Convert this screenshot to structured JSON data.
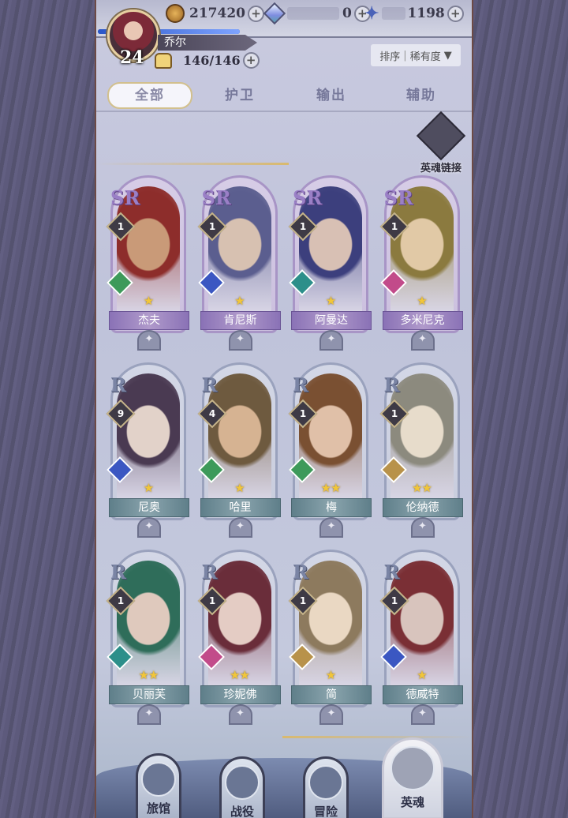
{
  "resources": {
    "gold": "217420",
    "crystal": "0",
    "star_gem": "1198"
  },
  "player": {
    "name": "乔尔",
    "level": "24",
    "stamina": "146/146"
  },
  "sort": {
    "label": "排序",
    "value": "稀有度",
    "arrow": "▼"
  },
  "tabs": [
    "全部",
    "护卫",
    "输出",
    "辅助"
  ],
  "soul_link_label": "英魂链接",
  "heroes": [
    {
      "name": "杰夫",
      "rarity": "SR",
      "level": "1",
      "stars": "★",
      "class_color": "#3d9a5a"
    },
    {
      "name": "肯尼斯",
      "rarity": "SR",
      "level": "1",
      "stars": "★",
      "class_color": "#3b57c2"
    },
    {
      "name": "阿曼达",
      "rarity": "SR",
      "level": "1",
      "stars": "★",
      "class_color": "#2c8f8a"
    },
    {
      "name": "多米尼克",
      "rarity": "SR",
      "level": "1",
      "stars": "★",
      "class_color": "#c24b8a"
    },
    {
      "name": "尼奥",
      "rarity": "R",
      "level": "9",
      "stars": "★",
      "class_color": "#3b57c2"
    },
    {
      "name": "哈里",
      "rarity": "R",
      "level": "4",
      "stars": "★",
      "class_color": "#3d9a5a"
    },
    {
      "name": "梅",
      "rarity": "R",
      "level": "1",
      "stars": "★★",
      "class_color": "#3d9a5a"
    },
    {
      "name": "伦纳德",
      "rarity": "R",
      "level": "1",
      "stars": "★★",
      "class_color": "#b8924a"
    },
    {
      "name": "贝丽芙",
      "rarity": "R",
      "level": "1",
      "stars": "★★",
      "class_color": "#2c8f8a"
    },
    {
      "name": "珍妮佛",
      "rarity": "R",
      "level": "1",
      "stars": "★★",
      "class_color": "#c24b8a"
    },
    {
      "name": "简",
      "rarity": "R",
      "level": "1",
      "stars": "★",
      "class_color": "#b8924a"
    },
    {
      "name": "德威特",
      "rarity": "R",
      "level": "1",
      "stars": "★",
      "class_color": "#3b57c2"
    }
  ],
  "bottom_nav": [
    "旅馆",
    "战役",
    "冒险",
    "英魂"
  ]
}
